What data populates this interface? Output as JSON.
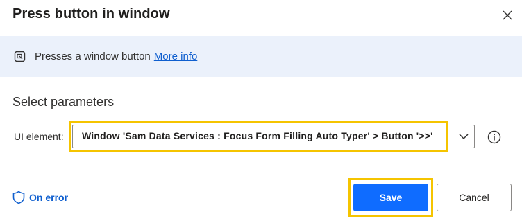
{
  "dialog": {
    "title": "Press button in window",
    "close_icon": "close-icon"
  },
  "info": {
    "icon": "window-action-icon",
    "description": "Presses a window button",
    "link_label": "More info"
  },
  "parameters": {
    "section_title": "Select parameters",
    "ui_element": {
      "label": "UI element:",
      "value": "Window 'Sam Data Services : Focus Form Filling Auto Typer' > Button '>>'",
      "dropdown_icon": "chevron-down-icon",
      "help_icon": "info-circle-icon"
    }
  },
  "footer": {
    "on_error_label": "On error",
    "on_error_icon": "shield-icon",
    "save_label": "Save",
    "cancel_label": "Cancel"
  },
  "colors": {
    "accent": "#0f6cff",
    "link": "#0f5fcf",
    "info_bar_bg": "#ebf1fb",
    "highlight": "#f5c400"
  }
}
